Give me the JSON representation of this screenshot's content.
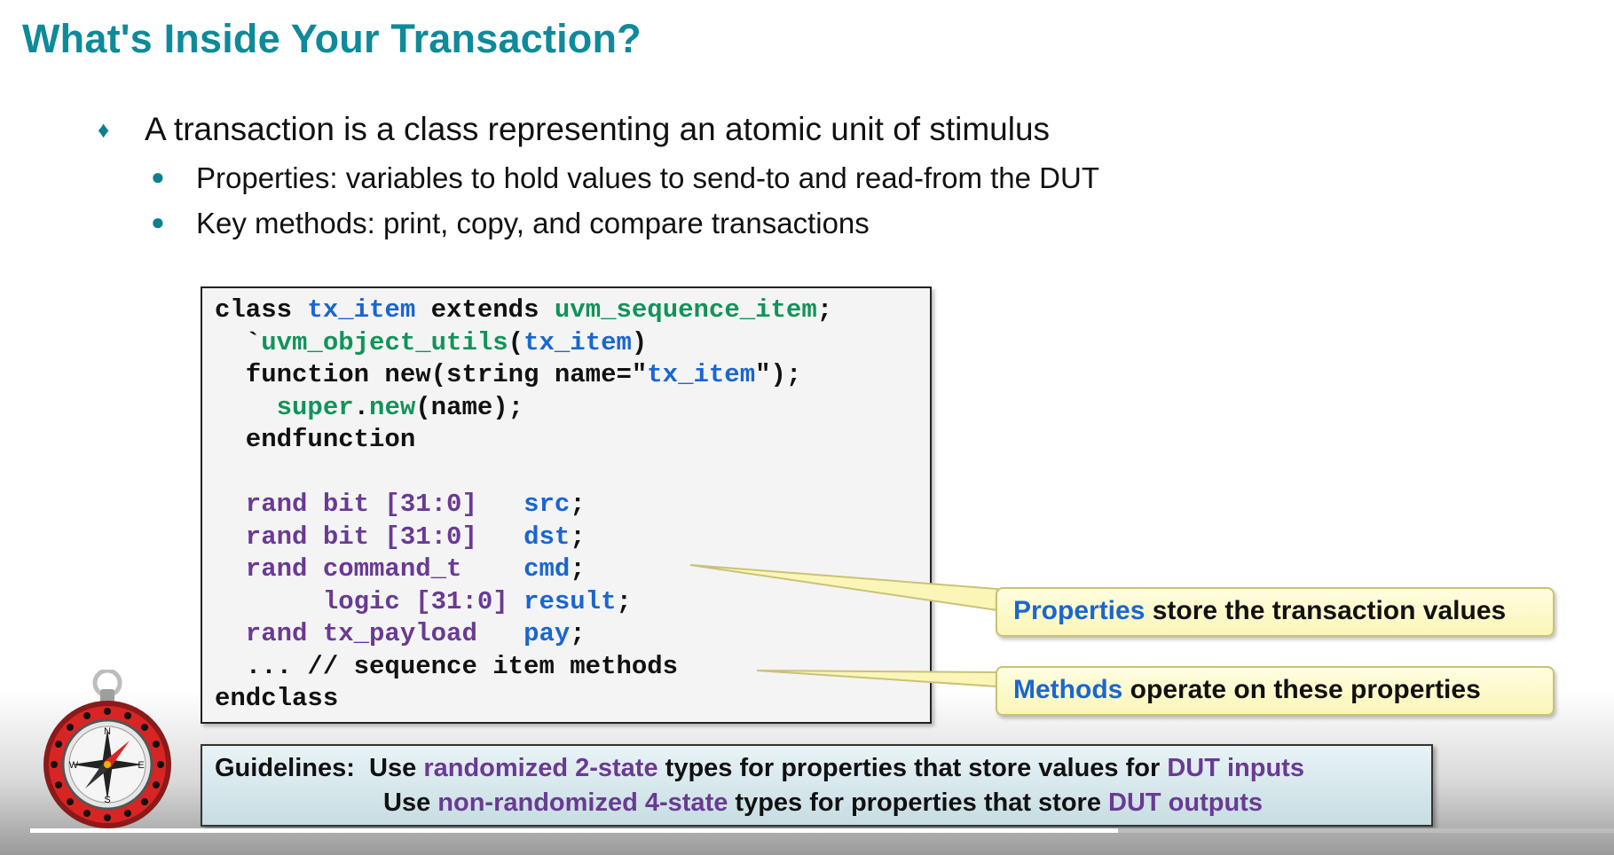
{
  "slide": {
    "title": "What's Inside Your Transaction?",
    "bullets": {
      "main": "A transaction is a class representing an atomic unit of stimulus",
      "sub": [
        "Properties: variables to hold values to send-to and read-from the DUT",
        "Key methods: print, copy, and compare transactions"
      ]
    },
    "code": {
      "l1": {
        "a": "class ",
        "b": "tx_item",
        "c": " extends ",
        "d": "uvm_sequence_item",
        "e": ";"
      },
      "l2": {
        "a": "  `",
        "b": "uvm_object_utils",
        "c": "(",
        "d": "tx_item",
        "e": ")"
      },
      "l3": {
        "a": "  function new(string name=\"",
        "b": "tx_item",
        "c": "\");"
      },
      "l4": {
        "a": "    ",
        "b": "super",
        "c": ".",
        "d": "new",
        "e": "(name);"
      },
      "l5": {
        "a": "  endfunction"
      },
      "l7": {
        "a": "  rand bit [31:0]   ",
        "b": "src",
        "c": ";"
      },
      "l8": {
        "a": "  rand bit [31:0]   ",
        "b": "dst",
        "c": ";"
      },
      "l9": {
        "a": "  rand command_t    ",
        "b": "cmd",
        "c": ";"
      },
      "l10": {
        "a": "       logic [31:0] ",
        "b": "result",
        "c": ";"
      },
      "l11": {
        "a": "  rand tx_payload   ",
        "b": "pay",
        "c": ";"
      },
      "l12": {
        "a": "  ... // sequence item methods"
      },
      "l13": {
        "a": "endclass"
      }
    },
    "callouts": {
      "properties": {
        "highlight": "Properties",
        "rest": " store the transaction values"
      },
      "methods": {
        "highlight": "Methods",
        "rest": " operate on these properties"
      }
    },
    "guidelines": {
      "label": "Guidelines:",
      "line1": {
        "a": "Use ",
        "b": "randomized 2-state",
        "c": " types for properties that store values for ",
        "d": "DUT inputs"
      },
      "line2": {
        "a": "Use ",
        "b": "non-randomized 4-state",
        "c": " types for properties that store ",
        "d": "DUT outputs"
      }
    },
    "compass_letters": {
      "n": "N",
      "e": "E",
      "s": "S",
      "w": "W"
    },
    "video_progress": 0.687
  },
  "colors": {
    "title": "#0e8a9a",
    "code_blue": "#1a66d1",
    "code_green": "#12935a",
    "code_purple": "#6a3a93",
    "callout_bg": "#fbf6b7"
  }
}
